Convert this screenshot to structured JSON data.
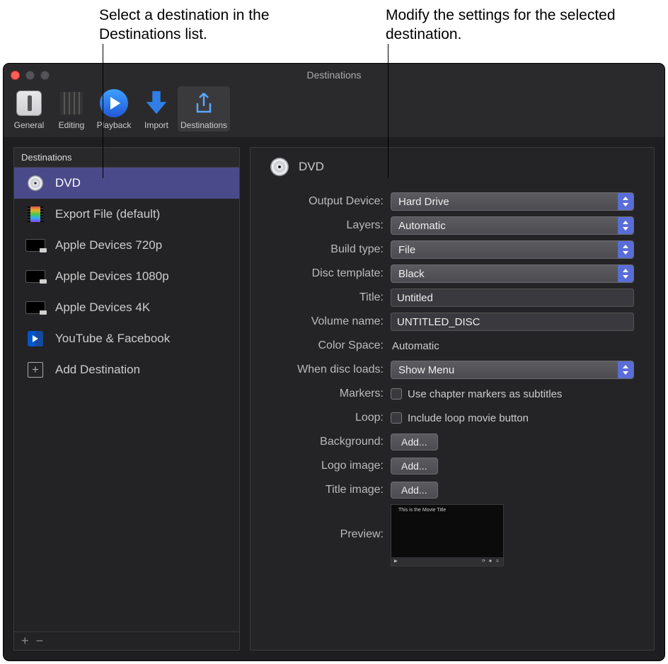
{
  "callouts": {
    "left": "Select a destination in the Destinations list.",
    "right": "Modify the settings for the selected destination."
  },
  "window": {
    "title": "Destinations"
  },
  "toolbar": {
    "general": "General",
    "editing": "Editing",
    "playback": "Playback",
    "import": "Import",
    "destinations": "Destinations"
  },
  "sidebar": {
    "header": "Destinations",
    "items": {
      "dvd": "DVD",
      "export_file": "Export File (default)",
      "apple_720": "Apple Devices 720p",
      "apple_1080": "Apple Devices 1080p",
      "apple_4k": "Apple Devices 4K",
      "yt_fb": "YouTube & Facebook",
      "add": "Add Destination"
    }
  },
  "detail": {
    "title": "DVD"
  },
  "form": {
    "output_device": {
      "label": "Output Device:",
      "value": "Hard Drive"
    },
    "layers": {
      "label": "Layers:",
      "value": "Automatic"
    },
    "build_type": {
      "label": "Build type:",
      "value": "File"
    },
    "disc_template": {
      "label": "Disc template:",
      "value": "Black"
    },
    "title": {
      "label": "Title:",
      "value": "Untitled"
    },
    "volume_name": {
      "label": "Volume name:",
      "value": "UNTITLED_DISC"
    },
    "color_space": {
      "label": "Color Space:",
      "value": "Automatic"
    },
    "disc_loads": {
      "label": "When disc loads:",
      "value": "Show Menu"
    },
    "markers": {
      "label": "Markers:",
      "option": "Use chapter markers as subtitles"
    },
    "loop": {
      "label": "Loop:",
      "option": "Include loop movie button"
    },
    "background": {
      "label": "Background:",
      "button": "Add..."
    },
    "logo": {
      "label": "Logo image:",
      "button": "Add..."
    },
    "title_image": {
      "label": "Title image:",
      "button": "Add..."
    },
    "preview": {
      "label": "Preview:",
      "text": "This is the Movie Title"
    }
  }
}
